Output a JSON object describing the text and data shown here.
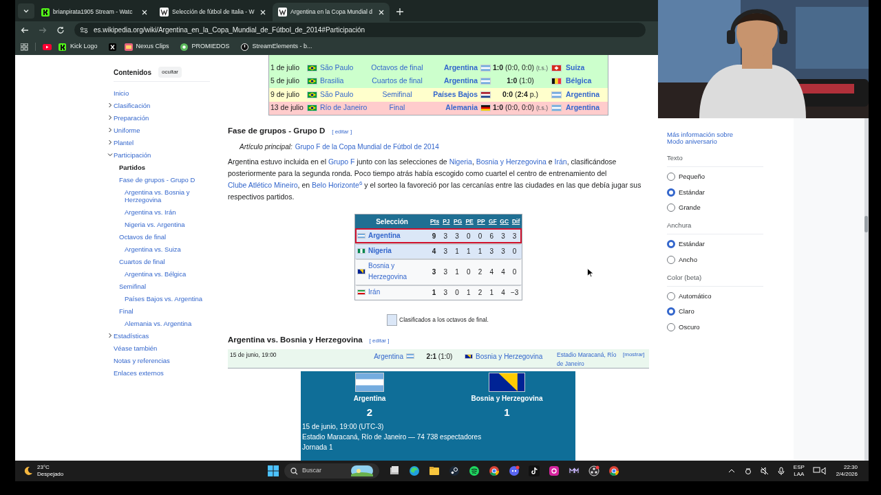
{
  "browser": {
    "tabs": [
      {
        "label": "brianpirata1905 Stream - Watc",
        "selected": false
      },
      {
        "label": "Selección de fútbol de Italia - W",
        "selected": false
      },
      {
        "label": "Argentina en la Copa Mundial d",
        "selected": true
      }
    ],
    "url": "es.wikipedia.org/wiki/Argentina_en_la_Copa_Mundial_de_Fútbol_de_2014#Participación",
    "bookmarks": [
      "Kick Logo",
      "Nexus Clips",
      "PROMIEDOS",
      "StreamElements - b..."
    ]
  },
  "toc": {
    "title": "Contenidos",
    "hide_button": "ocultar",
    "items": [
      {
        "label": "Inicio"
      },
      {
        "label": "Clasificación",
        "expanded": false
      },
      {
        "label": "Preparación",
        "expanded": false
      },
      {
        "label": "Uniforme",
        "expanded": false
      },
      {
        "label": "Plantel",
        "expanded": false
      },
      {
        "label": "Participación",
        "expanded": true,
        "children": [
          {
            "label": "Partidos",
            "current": true
          },
          {
            "label": "Fase de grupos - Grupo D",
            "children": [
              {
                "label": "Argentina vs. Bosnia y Herzegovina"
              },
              {
                "label": "Argentina vs. Irán"
              },
              {
                "label": "Nigeria vs. Argentina"
              }
            ]
          },
          {
            "label": "Octavos de final",
            "children": [
              {
                "label": "Argentina vs. Suiza"
              }
            ]
          },
          {
            "label": "Cuartos de final",
            "children": [
              {
                "label": "Argentina vs. Bélgica"
              }
            ]
          },
          {
            "label": "Semifinal",
            "children": [
              {
                "label": "Países Bajos vs. Argentina"
              }
            ]
          },
          {
            "label": "Final",
            "children": [
              {
                "label": "Alemania vs. Argentina"
              }
            ]
          }
        ]
      },
      {
        "label": "Estadísticas",
        "expanded": false
      },
      {
        "label": "Véase también"
      },
      {
        "label": "Notas y referencias"
      },
      {
        "label": "Enlaces externos"
      }
    ]
  },
  "results": [
    {
      "date": "1 de julio",
      "city": "São Paulo",
      "stage": "Octavos de final",
      "home": "Argentina",
      "score": "1:0",
      "detail": "(0:0, 0:0)",
      "note": "(t.s.)",
      "away": "Suiza",
      "color": "#ccffcc"
    },
    {
      "date": "5 de julio",
      "city": "Brasilia",
      "stage": "Cuartos de final",
      "home": "Argentina",
      "score": "1:0",
      "detail": "(1:0)",
      "away": "Bélgica",
      "color": "#ccffcc"
    },
    {
      "date": "9 de julio",
      "city": "São Paulo",
      "stage": "Semifinal",
      "home": "Países Bajos",
      "score": "0:0",
      "detail": "(**2:4** p.)",
      "away": "Argentina",
      "color": "#ffffcc"
    },
    {
      "date": "13 de julio",
      "city": "Río de Janeiro",
      "stage": "Final",
      "home": "Alemania",
      "score": "1:0",
      "detail": "(0:0, 0:0)",
      "note": "(t.s.)",
      "away": "Argentina",
      "color": "#ffcccc"
    }
  ],
  "group_section": {
    "heading": "Fase de grupos - Grupo D",
    "edit": "[ editar ]",
    "main_article_label": "Artículo principal:",
    "main_article": "Grupo F de la Copa Mundial de Fútbol de 2014",
    "paragraph": [
      {
        "kind": "text",
        "text": "Argentina estuvo incluida en el "
      },
      {
        "kind": "link",
        "text": "Grupo F"
      },
      {
        "kind": "text",
        "text": " junto con las selecciones de "
      },
      {
        "kind": "link",
        "text": "Nigeria"
      },
      {
        "kind": "text",
        "text": ", "
      },
      {
        "kind": "link",
        "text": "Bosnia y Herzegovina"
      },
      {
        "kind": "text",
        "text": " e "
      },
      {
        "kind": "link",
        "text": "Irán"
      },
      {
        "kind": "text",
        "text": ", clasificándose posteriormente para la segunda ronda. Poco tiempo atrás había escogido como cuartel el centro de entrenamiento del "
      },
      {
        "kind": "link",
        "text": "Clube Atlético Mineiro"
      },
      {
        "kind": "text",
        "text": ", en "
      },
      {
        "kind": "link",
        "text": "Belo Horizonte"
      },
      {
        "kind": "sup",
        "text": "6"
      },
      {
        "kind": "text",
        "text": "  y el sorteo la favoreció por las cercanías entre las ciudades en las que debía jugar sus respectivos partidos."
      }
    ],
    "standings": {
      "columns": [
        "Selección",
        "Pts",
        "PJ",
        "PG",
        "PE",
        "PP",
        "GF",
        "GC",
        "Dif"
      ],
      "rows": [
        {
          "cells": [
            "Argentina",
            "9",
            "3",
            "3",
            "0",
            "0",
            "6",
            "3",
            "3"
          ],
          "qualified": true,
          "selected": true
        },
        {
          "cells": [
            "Nigeria",
            "4",
            "3",
            "1",
            "1",
            "1",
            "3",
            "3",
            "0"
          ],
          "qualified": true,
          "selected": false
        },
        {
          "cells": [
            "Bosnia y Herzegovina",
            "3",
            "3",
            "1",
            "0",
            "2",
            "4",
            "4",
            "0"
          ],
          "qualified": false,
          "selected": false
        },
        {
          "cells": [
            "Irán",
            "1",
            "3",
            "0",
            "1",
            "2",
            "1",
            "4",
            "−3"
          ],
          "qualified": false,
          "selected": false
        }
      ]
    },
    "legend": "Clasificados a los octavos de final."
  },
  "match_section": {
    "heading": "Argentina vs. Bosnia y Herzegovina",
    "edit": "[ editar ]",
    "summary": {
      "date": "15 de junio, 19:00",
      "home": "Argentina",
      "score": "2:1",
      "detail": "(1:0)",
      "away": "Bosnia y Herzegovina",
      "venue": "Estadio Maracaná, Río de Janeiro",
      "toggle": "[mostrar]"
    },
    "box": {
      "home": "Argentina",
      "home_score": "2",
      "away": "Bosnia y Herzegovina",
      "away_score": "1",
      "lines": [
        "15 de junio, 19:00 (UTC-3)",
        "Estadio Maracaná, Río de Janeiro — 74 738 espectadores",
        "Jornada 1"
      ]
    }
  },
  "appearance": {
    "more_link": "Más información sobre Modo aniversario",
    "groups": [
      {
        "title": "Texto",
        "options": [
          {
            "label": "Pequeño",
            "selected": false
          },
          {
            "label": "Estándar",
            "selected": true
          },
          {
            "label": "Grande",
            "selected": false
          }
        ]
      },
      {
        "title": "Anchura",
        "options": [
          {
            "label": "Estándar",
            "selected": true
          },
          {
            "label": "Ancho",
            "selected": false
          }
        ]
      },
      {
        "title": "Color (beta)",
        "options": [
          {
            "label": "Automático",
            "selected": false
          },
          {
            "label": "Claro",
            "selected": true
          },
          {
            "label": "Oscuro",
            "selected": false
          }
        ]
      }
    ]
  },
  "taskbar": {
    "temperature": "23°C",
    "weather": "Despejado",
    "search": "Buscar",
    "language": "ESP",
    "layout": "LAA",
    "time": "22:30",
    "date": "2/4/2026"
  }
}
